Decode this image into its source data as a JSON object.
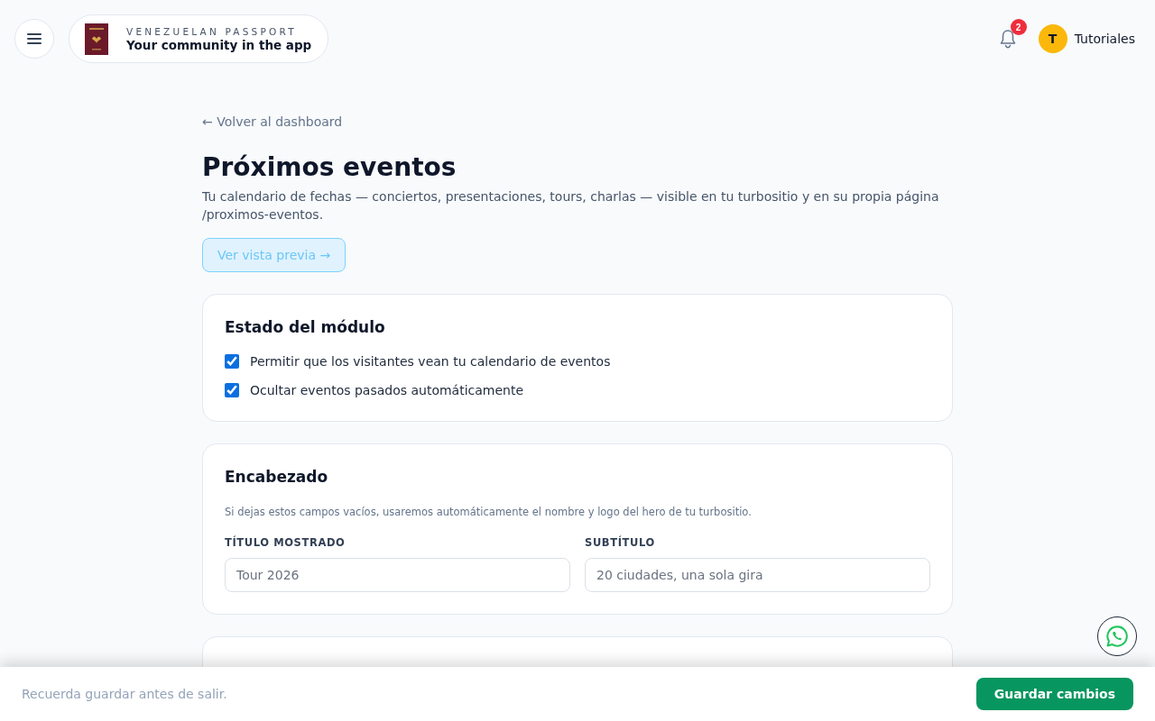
{
  "header": {
    "brand": {
      "eyebrow": "VENEZUELAN PASSPORT",
      "tagline": "Your community in the app"
    },
    "notifications": {
      "count": "2"
    },
    "user": {
      "initial": "T",
      "name": "Tutoriales"
    }
  },
  "back_link": "← Volver al dashboard",
  "page": {
    "title": "Próximos eventos",
    "description": "Tu calendario de fechas — conciertos, presentaciones, tours, charlas — visible en tu turbositio y en su propia página /proximos-eventos.",
    "preview_button": {
      "label": "Ver vista previa →",
      "disabled": true
    }
  },
  "sections": [
    {
      "kind": "checkboxes",
      "title": "Estado del módulo",
      "options": [
        {
          "label": "Permitir que los visitantes vean tu calendario de eventos",
          "checked": true
        },
        {
          "label": "Ocultar eventos pasados automáticamente",
          "checked": true
        }
      ]
    },
    {
      "kind": "fields",
      "title": "Encabezado",
      "hint": "Si dejas estos campos vacíos, usaremos automáticamente el nombre y logo del hero de tu turbositio.",
      "fields": [
        {
          "label": "TÍTULO MOSTRADO",
          "placeholder": "Tour 2026"
        },
        {
          "label": "SUBTÍTULO",
          "placeholder": "20 ciudades, una sola gira"
        }
      ]
    },
    {
      "kind": "obscured"
    }
  ],
  "save_bar": {
    "reminder": "Recuerda guardar antes de salir.",
    "button": "Guardar cambios"
  }
}
